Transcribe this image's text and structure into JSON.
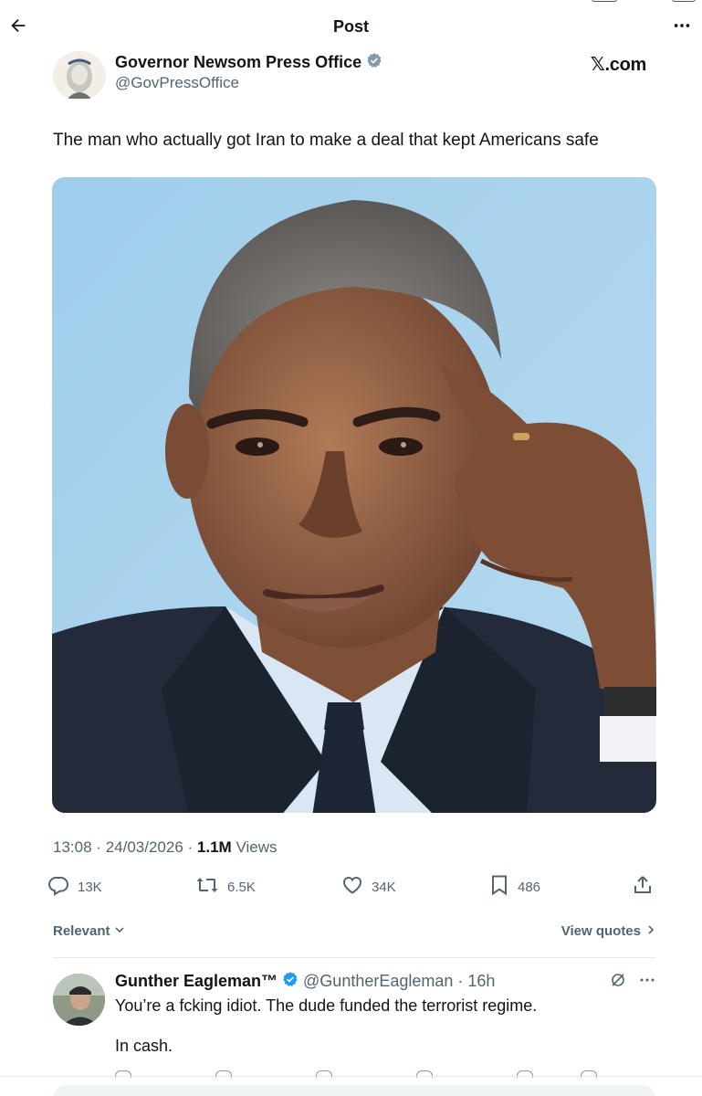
{
  "header": {
    "title": "Post",
    "back_icon": "arrow-left-icon",
    "more_icon": "more-horizontal-icon"
  },
  "post": {
    "author": {
      "name": "Governor Newsom Press Office",
      "handle": "@GovPressOffice",
      "verified_icon": "verified-badge-grey-icon"
    },
    "source_label": "𝕏.com",
    "text": "The man who actually got Iran to make a deal that kept Americans safe",
    "time": "13:08",
    "separator": "·",
    "date": "24/03/2026",
    "views_count": "1.1M",
    "views_label": "Views",
    "stats": {
      "replies": "13K",
      "reposts": "6.5K",
      "likes": "34K",
      "bookmarks": "486"
    }
  },
  "replies_bar": {
    "sort_label": "Relevant",
    "view_quotes_label": "View quotes"
  },
  "reply": {
    "name": "Gunther Eagleman™",
    "handle": "@GuntherEagleman",
    "separator": "·",
    "age": "16h",
    "verified_icon": "verified-badge-blue-icon",
    "text": "You’re a fcking idiot.  The dude funded the terrorist regime.\n\nIn cash."
  },
  "colors": {
    "text_primary": "#0f1419",
    "text_secondary": "#536471",
    "verified_blue": "#1d9bf0",
    "verified_grey": "#829aab",
    "photo_background": "#a9d2ec"
  }
}
